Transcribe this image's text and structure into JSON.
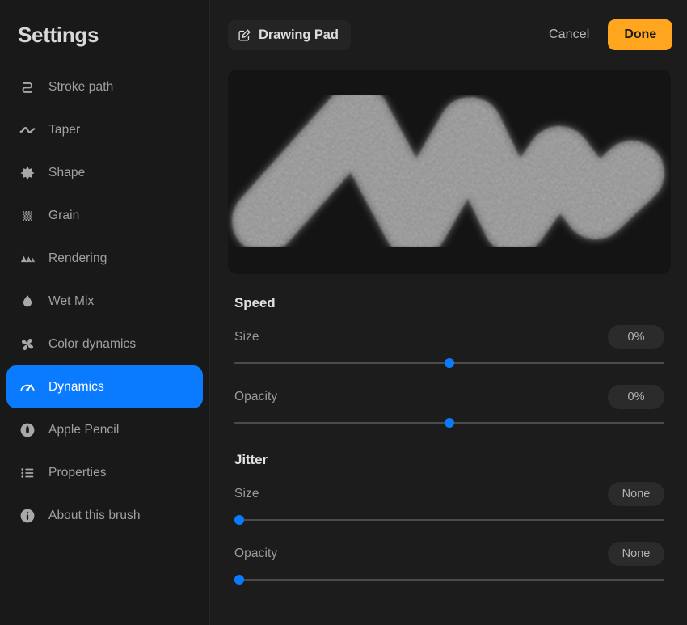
{
  "sidebar": {
    "title": "Settings",
    "items": [
      {
        "label": "Stroke path",
        "icon": "stroke-path-icon",
        "selected": false
      },
      {
        "label": "Taper",
        "icon": "taper-wave-icon",
        "selected": false
      },
      {
        "label": "Shape",
        "icon": "shape-starburst-icon",
        "selected": false
      },
      {
        "label": "Grain",
        "icon": "grain-checker-icon",
        "selected": false
      },
      {
        "label": "Rendering",
        "icon": "rendering-layers-icon",
        "selected": false
      },
      {
        "label": "Wet Mix",
        "icon": "wet-mix-droplet-icon",
        "selected": false
      },
      {
        "label": "Color dynamics",
        "icon": "color-pinwheel-icon",
        "selected": false
      },
      {
        "label": "Dynamics",
        "icon": "dynamics-gauge-icon",
        "selected": true
      },
      {
        "label": "Apple Pencil",
        "icon": "apple-pencil-icon",
        "selected": false
      },
      {
        "label": "Properties",
        "icon": "properties-list-icon",
        "selected": false
      },
      {
        "label": "About this brush",
        "icon": "info-circle-icon",
        "selected": false
      }
    ]
  },
  "header": {
    "brush_name": "Drawing Pad",
    "edit_icon": "compose-edit-icon",
    "cancel_label": "Cancel",
    "done_label": "Done"
  },
  "preview": {
    "description": "grainy-brush-stroke-preview"
  },
  "sections": [
    {
      "title": "Speed",
      "controls": [
        {
          "label": "Size",
          "value": "0%",
          "position": 50
        },
        {
          "label": "Opacity",
          "value": "0%",
          "position": 50
        }
      ]
    },
    {
      "title": "Jitter",
      "controls": [
        {
          "label": "Size",
          "value": "None",
          "position": 0
        },
        {
          "label": "Opacity",
          "value": "None",
          "position": 0
        }
      ]
    }
  ],
  "colors": {
    "accent_blue": "#0a7bff",
    "done_orange": "#ffa51e",
    "sidebar_bg": "#191919",
    "main_bg": "#1c1c1c",
    "canvas_bg": "#141414"
  }
}
